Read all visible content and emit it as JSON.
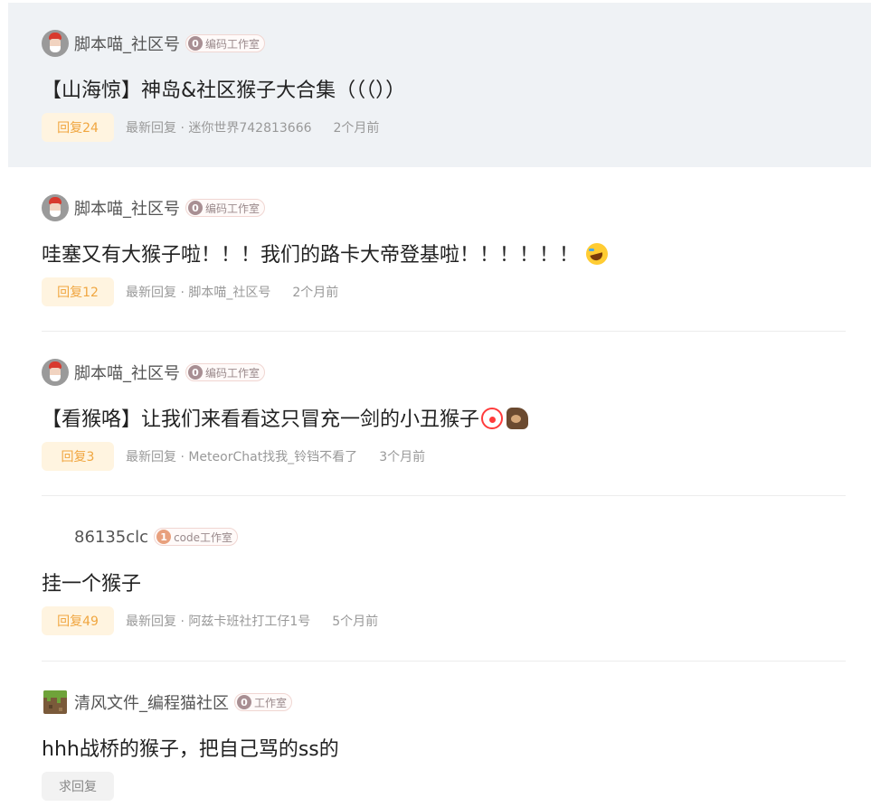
{
  "posts": [
    {
      "author": "脚本喵_社区号",
      "studio_level": "0",
      "studio": "编码工作室",
      "title": "【山海惊】神岛&社区猴子大合集（（（））",
      "reply_label": "回复24",
      "latest_reply": "最新回复 · 迷你世界742813666",
      "time": "2个月前",
      "hovered": true
    },
    {
      "author": "脚本喵_社区号",
      "studio_level": "0",
      "studio": "编码工作室",
      "title": "哇塞又有大猴子啦！！！我们的路卡大帝登基啦！！！！！！",
      "title_emoji": [
        "rolling-on-floor-laughing-emoji"
      ],
      "reply_label": "回复12",
      "latest_reply": "最新回复 · 脚本喵_社区号",
      "time": "2个月前"
    },
    {
      "author": "脚本喵_社区号",
      "studio_level": "0",
      "studio": "编码工作室",
      "title": "【看猴咯】让我们来看看这只冒充一剑的小丑猴子",
      "title_emoji": [
        "clown-emoji",
        "monkey-emoji"
      ],
      "reply_label": "回复3",
      "latest_reply": "最新回复 · MeteorChat找我_铃铛不看了",
      "time": "3个月前"
    },
    {
      "author": "86135clc",
      "studio_level": "1",
      "studio": "code工作室",
      "title": "挂一个猴子",
      "reply_label": "回复49",
      "latest_reply": "最新回复 · 阿兹卡班社打工仔1号",
      "time": "5个月前"
    },
    {
      "author": "清风文件_编程猫社区",
      "studio_level": "0",
      "studio": "工作室",
      "title": "hhh战桥的猴子，把自己骂的ss的",
      "reply_label": "求回复"
    }
  ],
  "colors": {
    "hover_bg": "#eff2f5",
    "reply_pill_bg": "#fff4e0",
    "reply_pill_text": "#f0a640",
    "no_reply_bg": "#f2f2f2"
  }
}
